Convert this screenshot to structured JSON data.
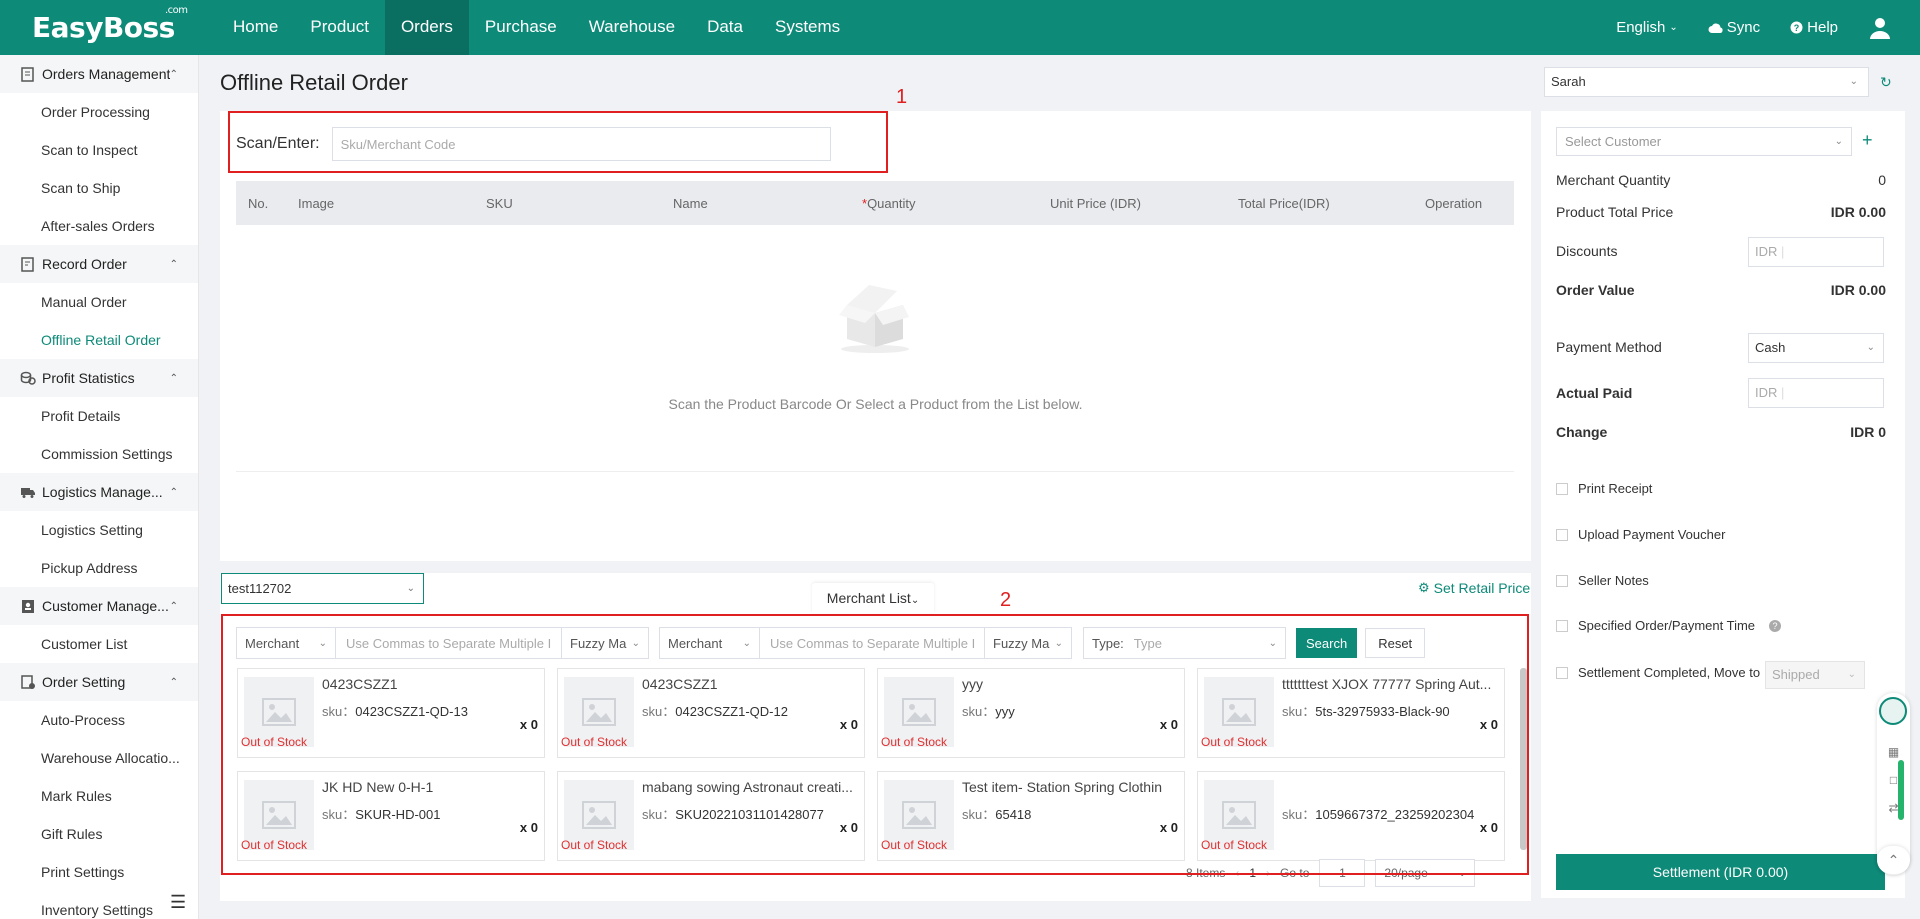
{
  "topnav": {
    "logo": "EasyBoss",
    "logo_suffix": ".com",
    "items": [
      "Home",
      "Product",
      "Orders",
      "Purchase",
      "Warehouse",
      "Data",
      "Systems"
    ],
    "active_index": 2,
    "language": "English",
    "sync": "Sync",
    "help": "Help"
  },
  "sidebar": {
    "groups": [
      {
        "label": "Orders Management",
        "items": [
          "Order Processing",
          "Scan to Inspect",
          "Scan to Ship",
          "After-sales Orders"
        ]
      },
      {
        "label": "Record Order",
        "items": [
          "Manual Order",
          "Offline Retail Order"
        ]
      },
      {
        "label": "Profit Statistics",
        "items": [
          "Profit Details",
          "Commission Settings"
        ]
      },
      {
        "label": "Logistics Manage...",
        "items": [
          "Logistics Setting",
          "Pickup Address"
        ]
      },
      {
        "label": "Customer Manage...",
        "items": [
          "Customer List"
        ]
      },
      {
        "label": "Order Setting",
        "items": [
          "Auto-Process",
          "Warehouse Allocatio...",
          "Mark Rules",
          "Gift Rules",
          "Print Settings",
          "Inventory Settings"
        ]
      }
    ],
    "active_item": "Offline Retail Order"
  },
  "main": {
    "page_title": "Offline Retail Order",
    "scan_label": "Scan/Enter:",
    "scan_placeholder": "Sku/Merchant Code",
    "columns": [
      "No.",
      "Image",
      "SKU",
      "Name",
      "Quantity",
      "Unit Price (IDR)",
      "Total Price(IDR)",
      "Operation"
    ],
    "quantity_required_mark": "*",
    "empty_text": "Scan the Product Barcode Or Select a Product from the List below."
  },
  "annotations": {
    "box1": "1",
    "box2": "2"
  },
  "merchant": {
    "store": "test112702",
    "tab_label": "Merchant List",
    "set_retail_price": "Set Retail Price",
    "filter1_select": "Merchant",
    "filter1_input": "Use Commas to Separate Multiple I",
    "filter1_match": "Fuzzy Ma",
    "filter2_select": "Merchant",
    "filter2_input": "Use Commas to Separate Multiple I",
    "filter2_match": "Fuzzy Ma",
    "type_label": "Type:",
    "type_placeholder": "Type",
    "search": "Search",
    "reset": "Reset",
    "sku_label": "sku：",
    "products": [
      {
        "name": "0423CSZZ1",
        "sku": "0423CSZZ1-QD-13",
        "qty": "x 0",
        "stock": "Out of Stock"
      },
      {
        "name": "0423CSZZ1",
        "sku": "0423CSZZ1-QD-12",
        "qty": "x 0",
        "stock": "Out of Stock"
      },
      {
        "name": "yyy",
        "sku": "yyy",
        "qty": "x 0",
        "stock": "Out of Stock"
      },
      {
        "name": "tttttttest XJOX 77777 Spring Aut...",
        "sku": "5ts-32975933-Black-90",
        "qty": "x 0",
        "stock": "Out of Stock"
      },
      {
        "name": "JK HD New 0-H-1",
        "sku": "SKUR-HD-001",
        "qty": "x 0",
        "stock": "Out of Stock"
      },
      {
        "name": "mabang sowing Astronaut creati...",
        "sku": "SKU20221031101428077",
        "qty": "x 0",
        "stock": "Out of Stock"
      },
      {
        "name": "Test item- Station Spring Clothin",
        "sku": "65418",
        "qty": "x 0",
        "stock": "Out of Stock"
      },
      {
        "name": "",
        "sku": "1059667372_23259202304",
        "qty": "x 0",
        "stock": "Out of Stock"
      }
    ],
    "pager": {
      "total": "8 Items",
      "page": "1",
      "goto_label": "Go to",
      "goto_value": "1",
      "page_size": "20/page"
    }
  },
  "right_panel": {
    "operator": "Sarah",
    "customer_placeholder": "Select  Customer",
    "merchant_quantity_label": "Merchant Quantity",
    "merchant_quantity": "0",
    "product_total_label": "Product Total Price",
    "product_total": "IDR 0.00",
    "discounts_label": "Discounts",
    "currency_prefix": "IDR",
    "order_value_label": "Order Value",
    "order_value": "IDR 0.00",
    "payment_method_label": "Payment Method",
    "payment_method": "Cash",
    "actual_paid_label": "Actual Paid",
    "change_label": "Change",
    "change": "IDR 0",
    "print_receipt": "Print Receipt",
    "upload_voucher": "Upload Payment Voucher",
    "seller_notes": "Seller Notes",
    "specified_time": "Specified Order/Payment Time",
    "settlement_completed": "Settlement Completed, Move to",
    "shipped": "Shipped",
    "settlement_button": "Settlement (IDR 0.00)"
  },
  "colors": {
    "primary": "#0d8a78",
    "annotation": "#e02020",
    "out_of_stock": "#e03030"
  }
}
